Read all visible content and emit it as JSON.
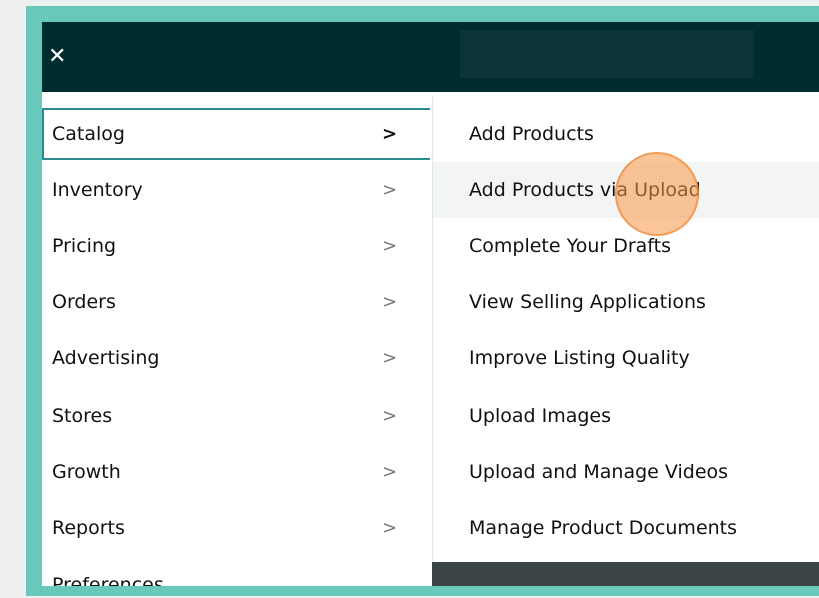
{
  "drawer": {
    "close_icon_glyph": "✕",
    "items": [
      {
        "label": "Catalog",
        "chevron": ">"
      },
      {
        "label": "Inventory",
        "chevron": ">"
      },
      {
        "label": "Pricing",
        "chevron": ">"
      },
      {
        "label": "Orders",
        "chevron": ">"
      },
      {
        "label": "Advertising",
        "chevron": ">"
      },
      {
        "label": "Stores",
        "chevron": ">"
      },
      {
        "label": "Growth",
        "chevron": ">"
      },
      {
        "label": "Reports",
        "chevron": ">"
      }
    ],
    "partial_item_label": "Preferences"
  },
  "flyout": {
    "items": [
      {
        "label": "Add Products"
      },
      {
        "label": "Add Products via Upload"
      },
      {
        "label": "Complete Your Drafts"
      },
      {
        "label": "View Selling Applications"
      },
      {
        "label": "Improve Listing Quality"
      },
      {
        "label": "Upload Images"
      },
      {
        "label": "Upload and Manage Videos"
      },
      {
        "label": "Manage Product Documents"
      }
    ]
  },
  "colors": {
    "header_bg": "#002b30",
    "active_border": "#2a8b95",
    "frame": "#68c9bb",
    "click_indicator": "#f59646"
  }
}
